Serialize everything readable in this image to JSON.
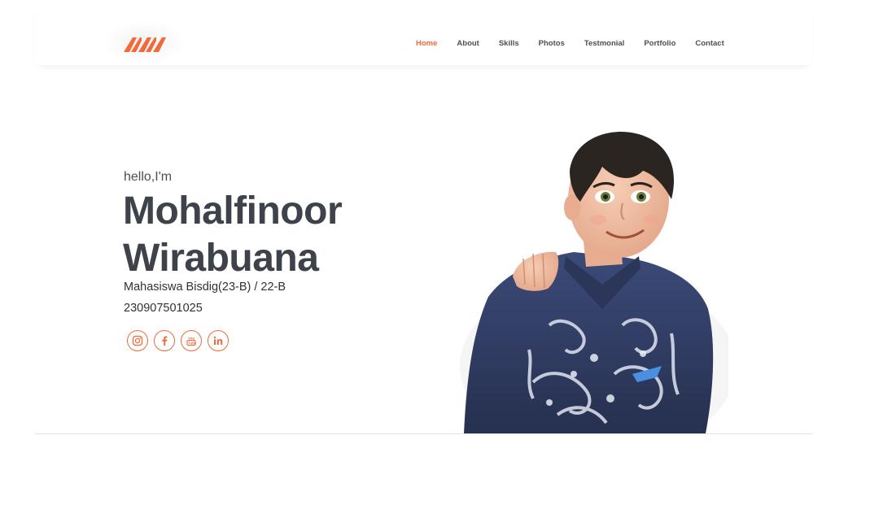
{
  "brand": {
    "logo": "logo-mark-icon",
    "accent": "#f06a3a"
  },
  "nav": {
    "items": [
      {
        "label": "Home",
        "active": true
      },
      {
        "label": "About"
      },
      {
        "label": "Skills"
      },
      {
        "label": "Photos"
      },
      {
        "label": "Testmonial"
      },
      {
        "label": "Portfolio"
      },
      {
        "label": "Contact"
      }
    ]
  },
  "hero": {
    "greeting": "hello,I'm",
    "first_name": "Mohalfinoor",
    "last_name": "Wirabuana",
    "subtitle": "Mahasiswa Bisdig(23-B) / 22-B",
    "id_number": "230907501025",
    "socials": [
      {
        "icon": "instagram-icon"
      },
      {
        "icon": "facebook-icon"
      },
      {
        "icon": "youtube-icon"
      },
      {
        "icon": "linkedin-icon"
      }
    ],
    "portrait": "profile-portrait"
  }
}
